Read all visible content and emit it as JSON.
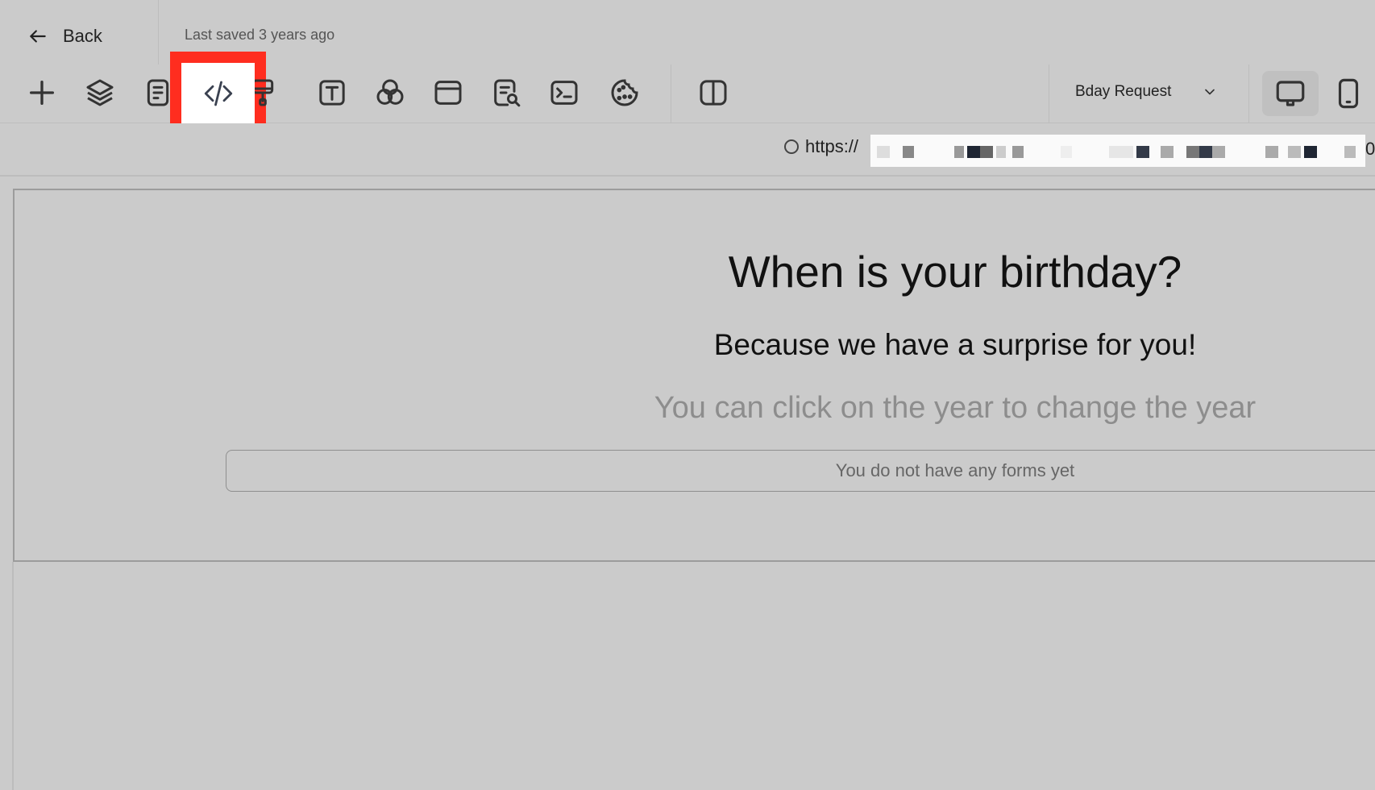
{
  "header": {
    "back_label": "Back",
    "saved_text": "Last saved 3 years ago",
    "page_select": "Bday Request"
  },
  "toolbar": {
    "tools": [
      {
        "name": "add-icon"
      },
      {
        "name": "layers-icon"
      },
      {
        "name": "pages-icon"
      },
      {
        "name": "code-icon",
        "highlighted": true
      },
      {
        "name": "paint-brush-icon"
      },
      {
        "name": "text-icon"
      },
      {
        "name": "color-circles-icon"
      },
      {
        "name": "layout-icon"
      },
      {
        "name": "seo-search-icon"
      },
      {
        "name": "terminal-icon"
      },
      {
        "name": "cookie-icon"
      },
      {
        "name": "split-view-icon"
      }
    ],
    "devices": [
      {
        "name": "desktop-icon",
        "active": true
      },
      {
        "name": "mobile-icon",
        "active": false
      }
    ]
  },
  "url": {
    "prefix": "https://",
    "trailing_char": "0"
  },
  "content": {
    "title": "When is your birthday?",
    "subtitle": "Because we have a surprise for you!",
    "hint": "You can click on the year to change the year",
    "forms_empty": "You do not have any forms yet"
  },
  "colors": {
    "background": "#cbcbcb",
    "highlight": "#ff2d1f",
    "hint_text": "#8d8d8d"
  }
}
